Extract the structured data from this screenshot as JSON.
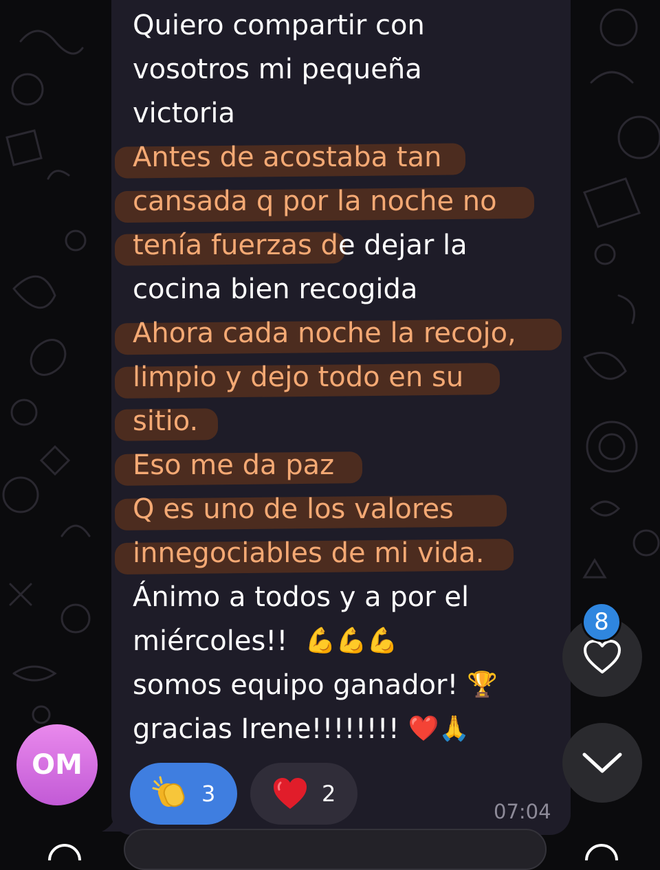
{
  "message": {
    "lines": [
      {
        "text": "Quiero compartir con",
        "highlight": false
      },
      {
        "text": "vosotros mi pequeña",
        "highlight": false
      },
      {
        "text": "victoria",
        "highlight": false
      },
      {
        "text": "Antes de acostaba tan",
        "highlight": true
      },
      {
        "text": "cansada q por la noche no",
        "highlight": true
      },
      {
        "text_highlighted": "tenía fuerzas d",
        "text_plain": "e dejar la"
      },
      {
        "text": "cocina bien recogida",
        "highlight": false
      },
      {
        "text": "Ahora cada noche la recojo,",
        "highlight": true
      },
      {
        "text": "limpio y dejo todo en su",
        "highlight": true
      },
      {
        "text": "sitio.",
        "highlight": true
      },
      {
        "text": "Eso me da paz",
        "highlight": true
      },
      {
        "text": "Q es uno de los valores",
        "highlight": true
      },
      {
        "text": "innegociables de mi vida.",
        "highlight": true
      },
      {
        "text": "Ánimo a todos y a por el",
        "highlight": false
      },
      {
        "text": "miércoles!!",
        "emoji": "💪💪💪"
      },
      {
        "text": "somos equipo ganador!",
        "emoji": "🏆"
      },
      {
        "text": "gracias Irene!!!!!!!!",
        "emoji": "❤️🙏"
      }
    ],
    "time": "07:04"
  },
  "sender": {
    "initials": "OM",
    "avatar_color": "#d070e0"
  },
  "reactions": [
    {
      "emoji": "clapping-hands",
      "count": "3",
      "selected": true
    },
    {
      "emoji": "red-heart",
      "count": "2",
      "selected": false
    }
  ],
  "floating": {
    "heart_badge": "8"
  },
  "colors": {
    "bubble": "#1e1c28",
    "highlight_text": "#f4a974",
    "selected_reaction": "#3f7ee0",
    "badge": "#2f86df"
  }
}
